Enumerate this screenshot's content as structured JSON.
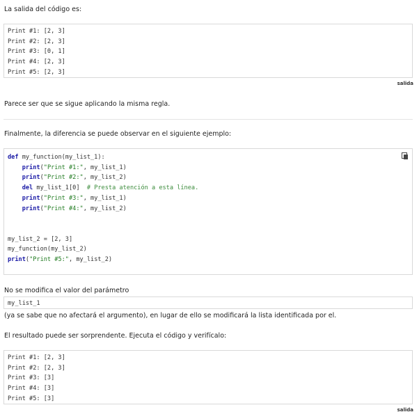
{
  "intro_text": "La salida del código es:",
  "output1": {
    "lines": [
      "Print #1: [2, 3]",
      "Print #2: [2, 3]",
      "Print #3: [0, 1]",
      "Print #4: [2, 3]",
      "Print #5: [2, 3]"
    ],
    "label": "salida"
  },
  "para_same_rule": "Parece ser que se sigue aplicando la misma regla.",
  "para_finally": "Finalmente, la diferencia se puede observar en el siguiente ejemplo:",
  "code": {
    "copy_icon": "copy-icon",
    "l1": {
      "kw": "def",
      "rest": " my_function(my_list_1):"
    },
    "l2": {
      "fn": "print",
      "p1": "(",
      "str": "\"Print #1:\"",
      "rest": ", my_list_1)"
    },
    "l3": {
      "fn": "print",
      "p1": "(",
      "str": "\"Print #2:\"",
      "rest": ", my_list_2)"
    },
    "l4": {
      "kw": "del",
      "rest": " my_list_1[0]",
      "num": "0",
      "comment": "# Presta atención a esta línea."
    },
    "l5": {
      "fn": "print",
      "p1": "(",
      "str": "\"Print #3:\"",
      "rest": ", my_list_1)"
    },
    "l6": {
      "fn": "print",
      "p1": "(",
      "str": "\"Print #4:\"",
      "rest": ", my_list_2)"
    },
    "l9": "my_list_2 = [2, 3]",
    "l10": "my_function(my_list_2)",
    "l11": {
      "fn": "print",
      "p1": "(",
      "str": "\"Print #5:\"",
      "rest": ", my_list_2)"
    }
  },
  "para_param": "No se modifica el valor del parámetro",
  "param_name": "my_list_1",
  "para_argument": "(ya se sabe que no afectará el argumento), en lugar de ello se modificará la lista identificada por el.",
  "para_result": "El resultado puede ser sorprendente. Ejecuta el código y verifícalo:",
  "output2": {
    "lines": [
      "Print #1: [2, 3]",
      "Print #2: [2, 3]",
      "Print #3: [3]",
      "Print #4: [3]",
      "Print #5: [3]"
    ],
    "label": "salida"
  }
}
